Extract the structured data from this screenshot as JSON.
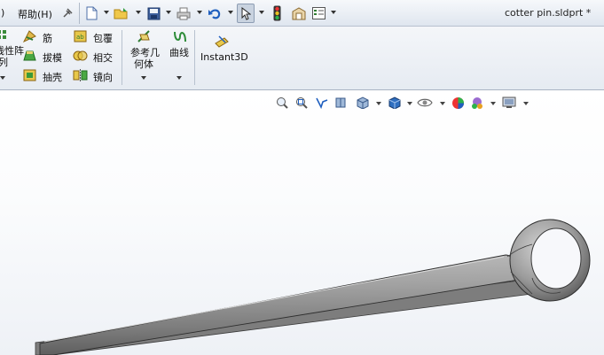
{
  "menu": {
    "partial_left": ")",
    "help": "帮助(H)"
  },
  "window": {
    "title": "cotter pin.sldprt *"
  },
  "ribbon": {
    "pattern_label_line1": "线性阵",
    "pattern_label_line2": "列",
    "rib": "筋",
    "draft": "拔模",
    "shell": "抽壳",
    "wrap": "包覆",
    "intersect": "相交",
    "mirror": "镜向",
    "ref_geometry_line1": "参考几",
    "ref_geometry_line2": "何体",
    "curves": "曲线",
    "instant3d": "Instant3D"
  },
  "icons": {
    "toolbar": [
      "pin-icon",
      "new-document-icon",
      "open-folder-icon",
      "save-icon",
      "print-icon",
      "undo-icon",
      "select-cursor-icon",
      "traffic-light-icon",
      "file-properties-icon",
      "options-icon"
    ],
    "view": [
      "zoom-to-fit-icon",
      "zoom-area-icon",
      "previous-view-icon",
      "section-view-icon",
      "view-orientation-icon",
      "display-style-icon",
      "hide-show-icon",
      "edit-appearance-icon",
      "apply-scene-icon",
      "view-settings-icon"
    ]
  },
  "colors": {
    "accent": "#1f5fbf",
    "part_metal": "#9a9a9a"
  }
}
